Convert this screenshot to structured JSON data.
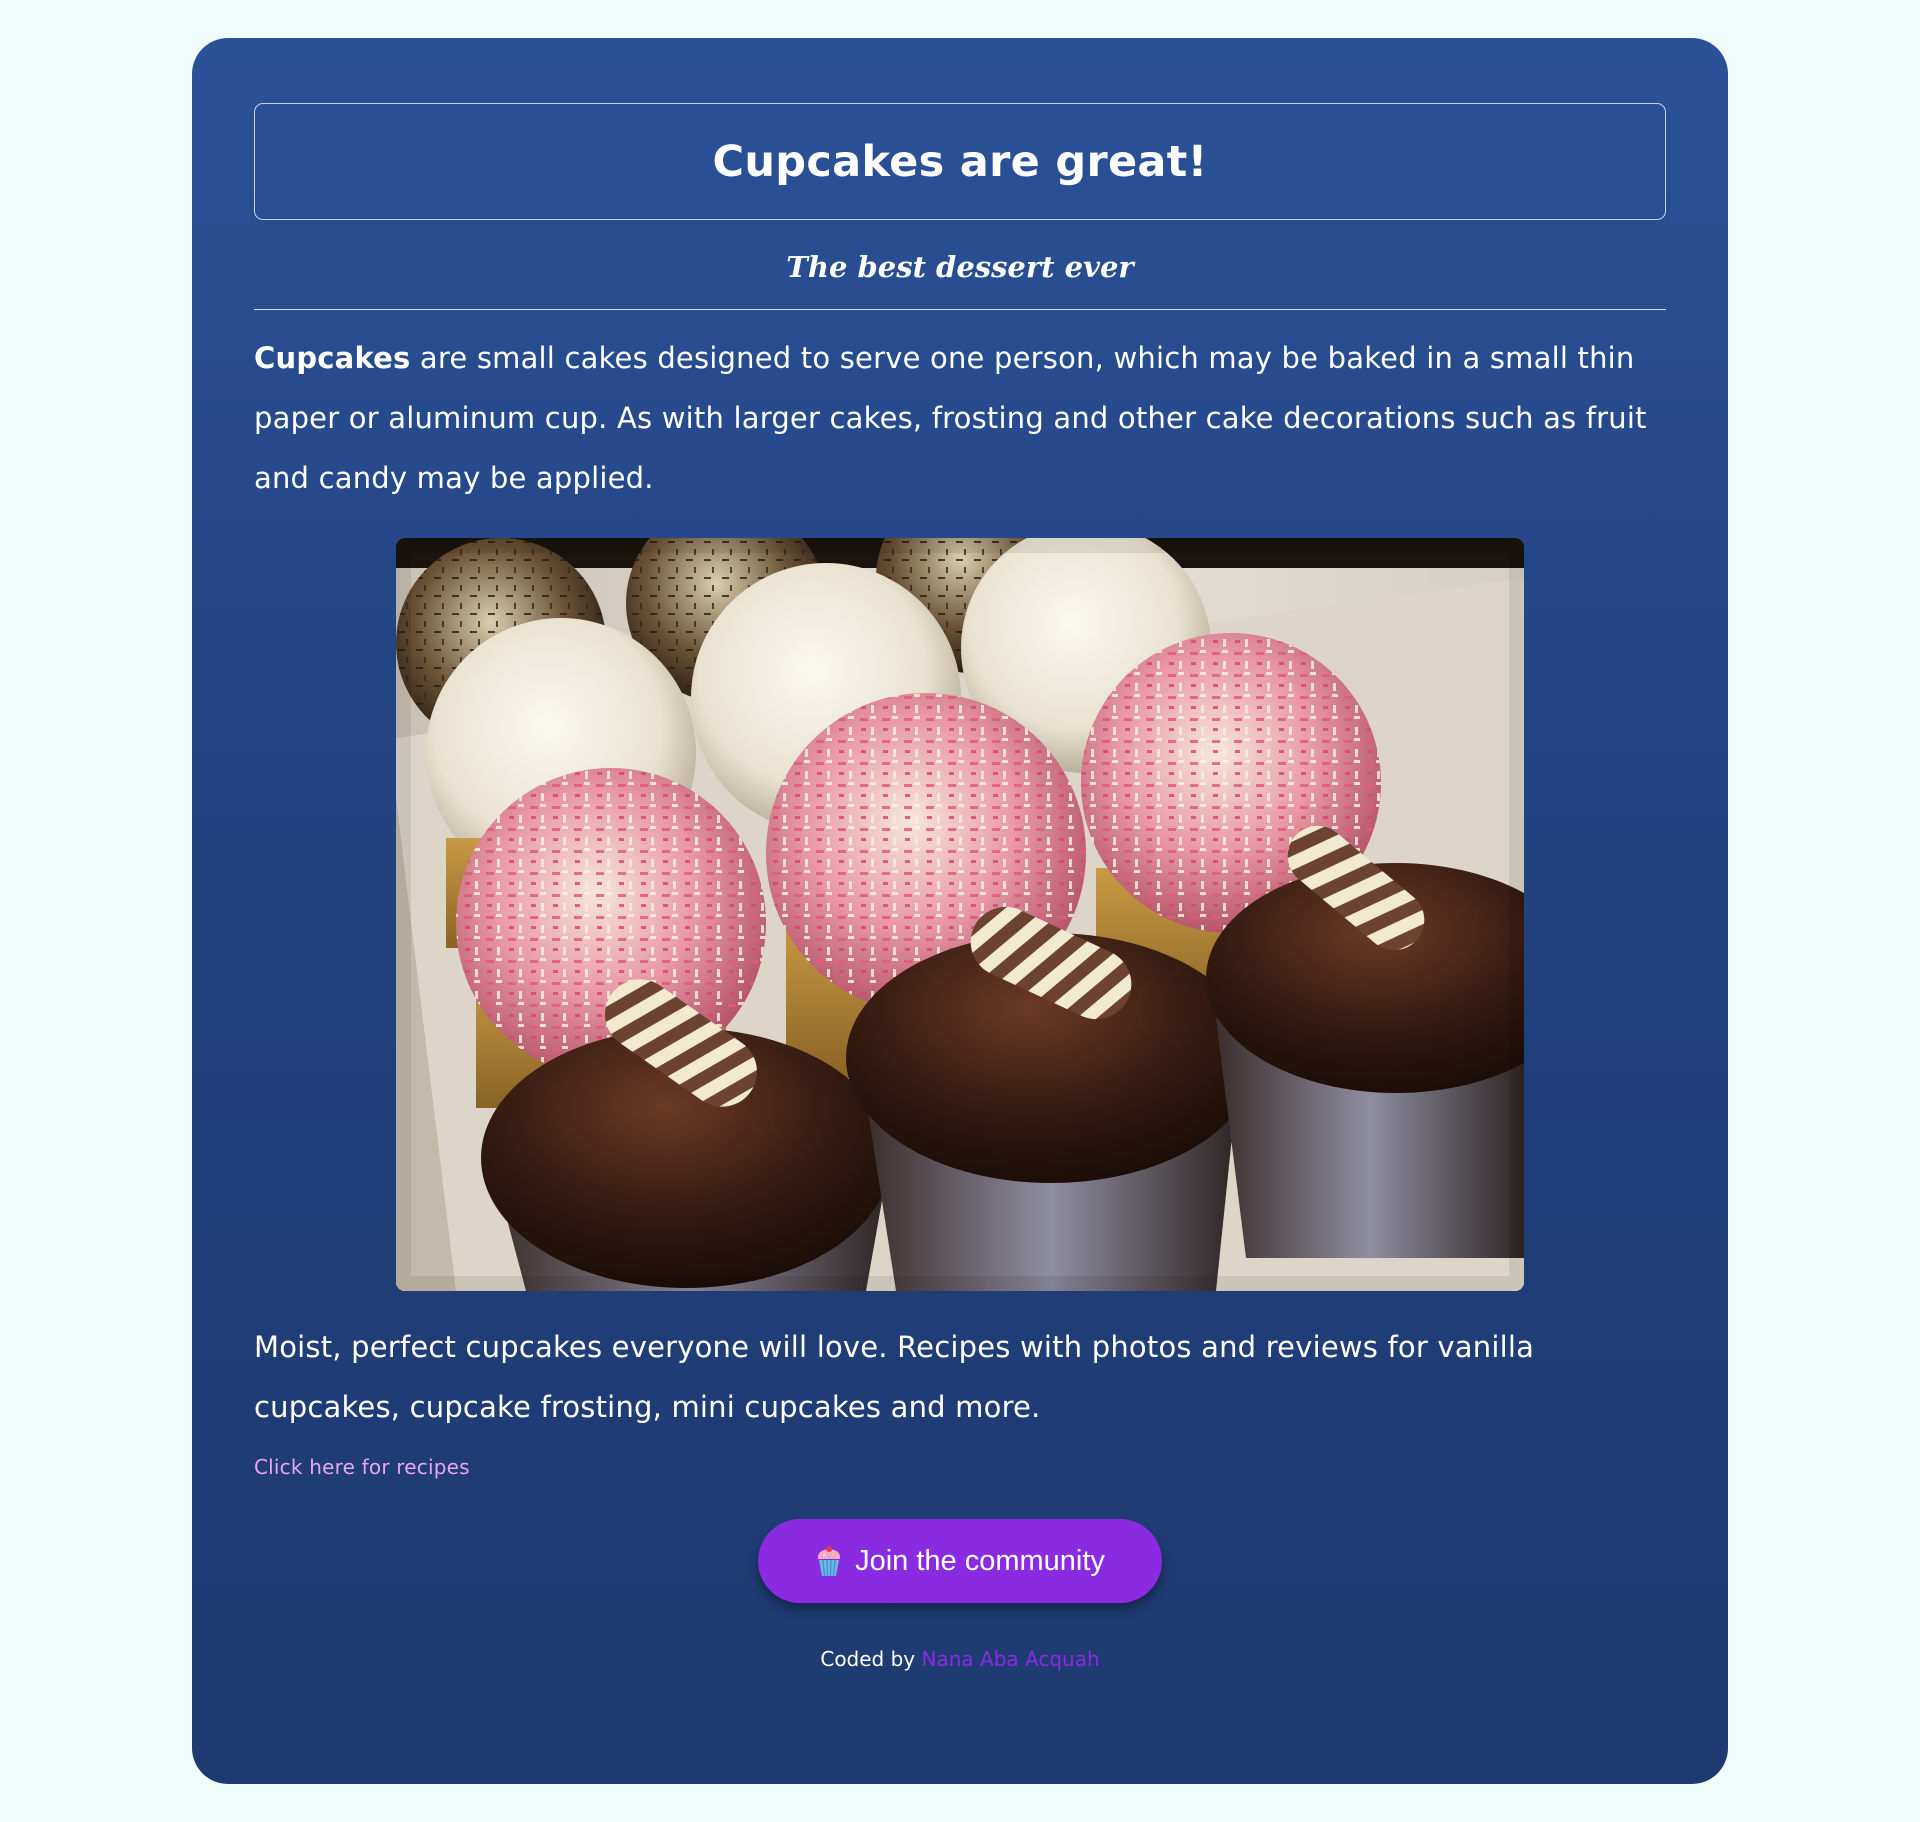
{
  "header": {
    "title": "Cupcakes are great!",
    "subtitle": "The best dessert ever"
  },
  "intro": {
    "bold": "Cupcakes",
    "text": " are small cakes designed to serve one person, which may be baked in a small thin paper or aluminum cup. As with larger cakes, frosting and other cake decorations such as fruit and candy may be applied."
  },
  "photo": {
    "alt": "Cupcakes"
  },
  "description": "Moist, perfect cupcakes everyone will love. Recipes with photos and reviews for vanilla cupcakes, cupcake frosting, mini cupcakes and more.",
  "recipes_link": "Click here for recipes",
  "cta": {
    "icon": "cupcake-icon",
    "label": "Join the community"
  },
  "footer": {
    "prefix": "Coded by ",
    "author": "Nana Aba Acquah"
  },
  "colors": {
    "page_background": "#effefd",
    "card_gradient_top": "#2a5298",
    "card_gradient_bottom": "#1e3a70",
    "accent": "#8a2be2",
    "link": "#e7a6ee"
  }
}
